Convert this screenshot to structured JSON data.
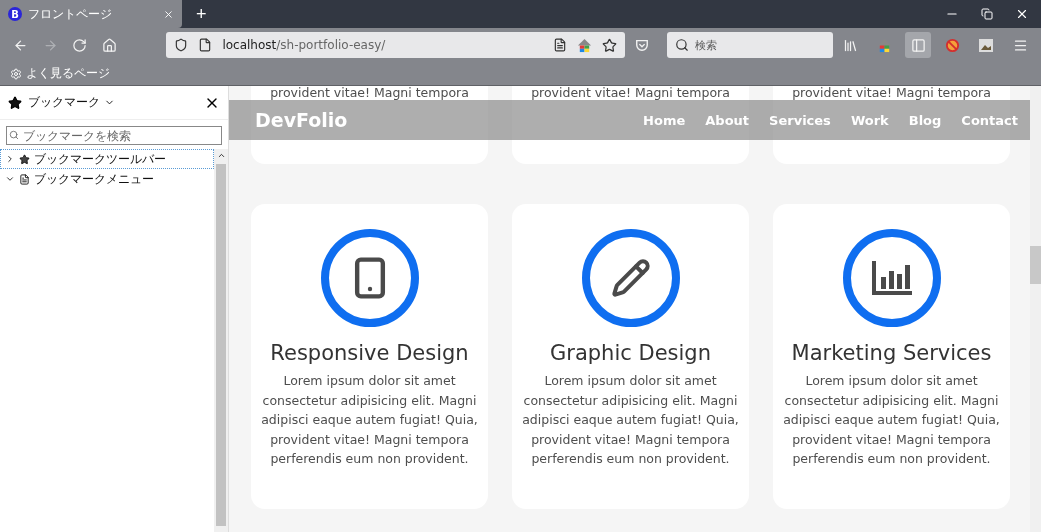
{
  "browser": {
    "tab": {
      "favicon": "B",
      "title": "フロントページ",
      "selected": true
    },
    "new_tab": "+",
    "address": {
      "host": "localhost",
      "path": "/sh-portfolio-easy/"
    },
    "search": {
      "placeholder": "検索"
    },
    "bookmarks_bar": [
      {
        "label": "よく見るページ"
      }
    ]
  },
  "sidebar": {
    "title": "ブックマーク",
    "search": {
      "placeholder": "ブックマークを検索"
    },
    "tree": [
      {
        "label": "ブックマークツールバー",
        "expanded": false,
        "selected": true
      },
      {
        "label": "ブックマークメニュー",
        "expanded": true,
        "selected": false
      }
    ]
  },
  "page": {
    "navbar": {
      "brand": "DevFolio",
      "links": [
        {
          "label": "Home"
        },
        {
          "label": "About"
        },
        {
          "label": "Services"
        },
        {
          "label": "Work"
        },
        {
          "label": "Blog"
        },
        {
          "label": "Contact"
        }
      ]
    },
    "top_cards": [
      {
        "text": "provident vitae! Magni tempora"
      },
      {
        "text": "provident vitae! Magni tempora"
      },
      {
        "text": "provident vitae! Magni tempora"
      }
    ],
    "services": [
      {
        "kind": "phone",
        "title": "Responsive Design",
        "text": "Lorem ipsum dolor sit amet consectetur adipisicing elit. Magni adipisci eaque autem fugiat! Quia, provident vitae! Magni tempora perferendis eum non provident."
      },
      {
        "kind": "pencil",
        "title": "Graphic Design",
        "text": "Lorem ipsum dolor sit amet consectetur adipisicing elit. Magni adipisci eaque autem fugiat! Quia, provident vitae! Magni tempora perferendis eum non provident."
      },
      {
        "kind": "chart",
        "title": "Marketing Services",
        "text": "Lorem ipsum dolor sit amet consectetur adipisicing elit. Magni adipisci eaque autem fugiat! Quia, provident vitae! Magni tempora perferendis eum non provident."
      }
    ]
  }
}
